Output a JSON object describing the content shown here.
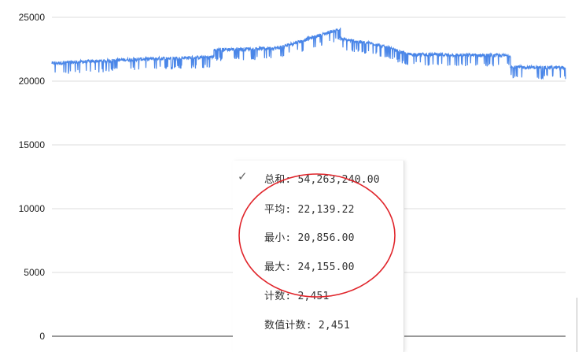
{
  "chart_data": {
    "type": "line",
    "title": "",
    "xlabel": "",
    "ylabel": "",
    "ylim": [
      0,
      25000
    ],
    "yticks": [
      0,
      5000,
      10000,
      15000,
      20000,
      25000
    ],
    "grid": true,
    "legend": "none",
    "series": [
      {
        "color": "#4a86e8",
        "count": 2451,
        "segments": [
          {
            "from_index": 0,
            "to_index": 500,
            "start": 21400,
            "end": 21700
          },
          {
            "from_index": 500,
            "to_index": 1000,
            "start": 21700,
            "end": 21900
          },
          {
            "from_index": 1000,
            "to_index": 1400,
            "start": 22450,
            "end": 22600
          },
          {
            "from_index": 1400,
            "to_index": 1780,
            "start": 22600,
            "end": 24100
          },
          {
            "from_index": 1780,
            "to_index": 2000,
            "start": 23300,
            "end": 22900
          },
          {
            "from_index": 2000,
            "to_index": 2200,
            "start": 22900,
            "end": 22100
          },
          {
            "from_index": 2200,
            "to_index": 2830,
            "start": 22100,
            "end": 22000
          },
          {
            "from_index": 2830,
            "to_index": 3170,
            "start": 21100,
            "end": 21050
          }
        ]
      }
    ]
  },
  "stats_menu": {
    "items": [
      {
        "label": "总和: 54,263,240.00",
        "checked": true
      },
      {
        "label": "平均: 22,139.22",
        "checked": false
      },
      {
        "label": "最小: 20,856.00",
        "checked": false
      },
      {
        "label": "最大: 24,155.00",
        "checked": false
      },
      {
        "label": "计数: 2,451",
        "checked": false
      },
      {
        "label": "数值计数: 2,451",
        "checked": false
      }
    ],
    "check_icon": "checkmark-icon",
    "highlight_color": "#e0242a"
  }
}
